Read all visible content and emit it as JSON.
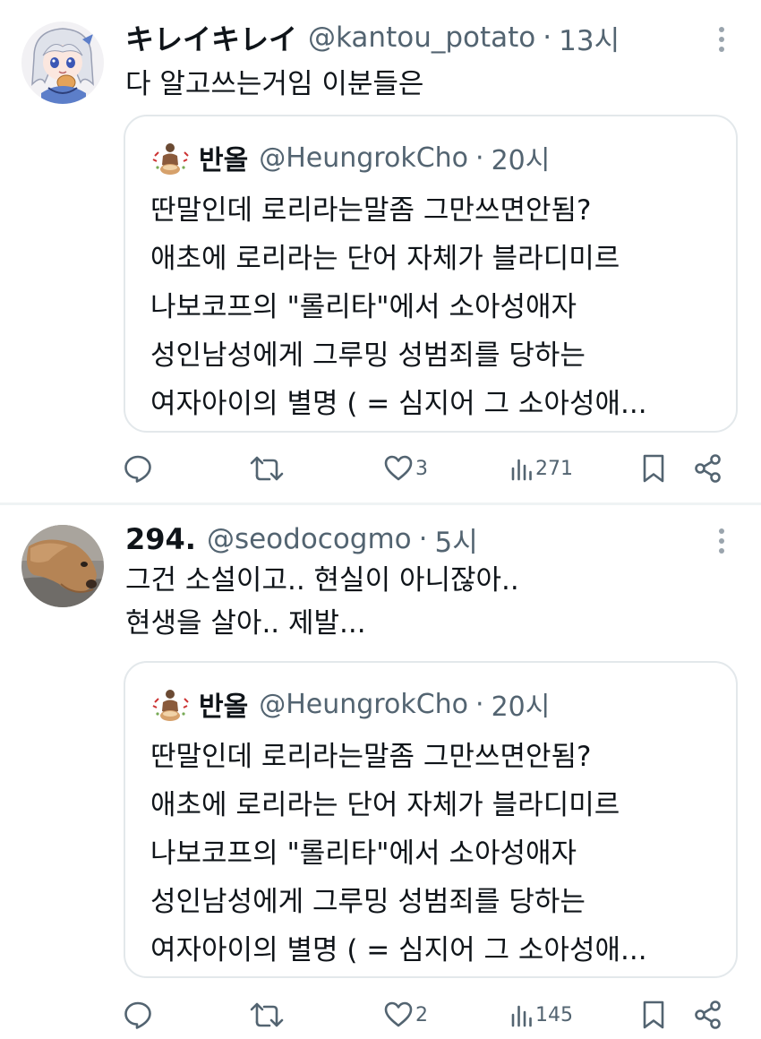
{
  "tweets": [
    {
      "author": {
        "display_name": "キレイキレイ",
        "handle": "@kantou_potato",
        "avatar_icon": "anime-character-avatar"
      },
      "separator": "·",
      "time": "13시",
      "text": "다 알고쓰는거임 이분들은",
      "quoted": {
        "author": {
          "display_name": "반올",
          "handle": "@HeungrokCho",
          "avatar_icon": "figure-avatar"
        },
        "separator": "·",
        "time": "20시",
        "text": "딴말인데 로리라는말좀 그만쓰면안됨?\n애초에 로리라는 단어 자체가 블라디미르\n나보코프의 \"롤리타\"에서 소아성애자\n성인남성에게 그루밍 성범죄를 당하는\n여자아이의 별명 ( = 심지어 그 소아성애..."
      },
      "actions": {
        "reply_icon": "reply-icon",
        "retweet_icon": "retweet-icon",
        "like_icon": "heart-icon",
        "like_count": "3",
        "views_icon": "views-icon",
        "views_count": "271",
        "bookmark_icon": "bookmark-icon",
        "share_icon": "share-icon"
      }
    },
    {
      "author": {
        "display_name": "294.",
        "handle": "@seodocogmo",
        "avatar_icon": "deer-photo-avatar"
      },
      "separator": "·",
      "time": "5시",
      "text": "그건 소설이고.. 현실이 아니잖아..\n현생을 살아.. 제발...",
      "quoted": {
        "author": {
          "display_name": "반올",
          "handle": "@HeungrokCho",
          "avatar_icon": "figure-avatar"
        },
        "separator": "·",
        "time": "20시",
        "text": "딴말인데 로리라는말좀 그만쓰면안됨?\n애초에 로리라는 단어 자체가 블라디미르\n나보코프의 \"롤리타\"에서 소아성애자\n성인남성에게 그루밍 성범죄를 당하는\n여자아이의 별명 ( = 심지어 그 소아성애..."
      },
      "actions": {
        "reply_icon": "reply-icon",
        "retweet_icon": "retweet-icon",
        "like_icon": "heart-icon",
        "like_count": "2",
        "views_icon": "views-icon",
        "views_count": "145",
        "bookmark_icon": "bookmark-icon",
        "share_icon": "share-icon"
      }
    }
  ],
  "colors": {
    "text_primary": "#0f1419",
    "text_secondary": "#536471",
    "border": "#e3e8eb",
    "divider": "#eff3f4"
  }
}
